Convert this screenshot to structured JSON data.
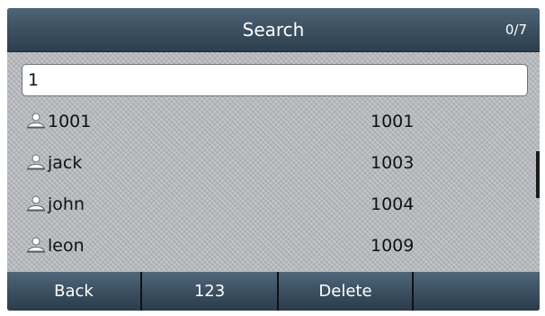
{
  "header": {
    "title": "Search",
    "counter": "0/7"
  },
  "search": {
    "value": "1"
  },
  "contacts": [
    {
      "name": "1001",
      "number": "1001",
      "icon": "contact-icon"
    },
    {
      "name": "jack",
      "number": "1003",
      "icon": "contact-icon"
    },
    {
      "name": "john",
      "number": "1004",
      "icon": "contact-icon"
    },
    {
      "name": "leon",
      "number": "1009",
      "icon": "contact-icon"
    }
  ],
  "softkeys": {
    "back": "Back",
    "input_mode": "123",
    "delete": "Delete",
    "empty": ""
  },
  "colors": {
    "title_bar": "#3d5263",
    "list_background": "#b9bcbf",
    "softkey": "#3b5062",
    "text": "#111111"
  }
}
